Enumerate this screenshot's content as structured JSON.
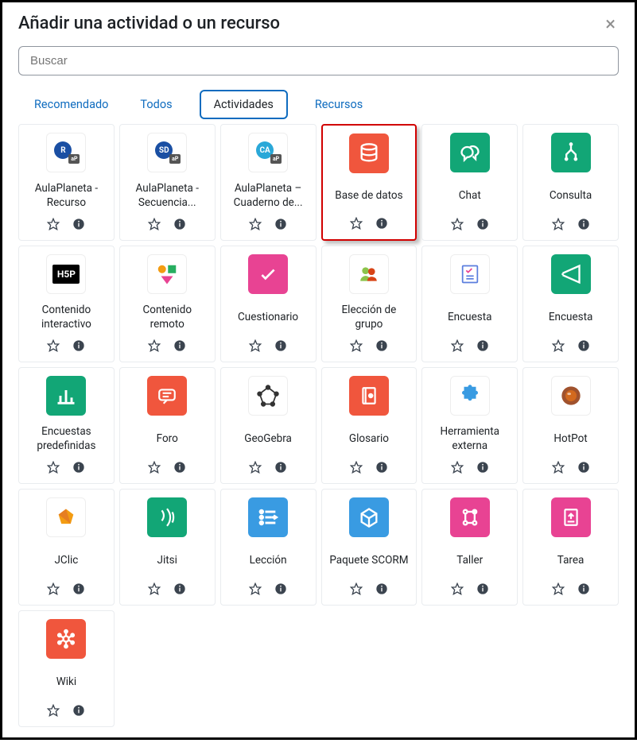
{
  "header": {
    "title": "Añadir una actividad o un recurso"
  },
  "search": {
    "placeholder": "Buscar"
  },
  "tabs": [
    {
      "label": "Recomendado",
      "active": false
    },
    {
      "label": "Todos",
      "active": false
    },
    {
      "label": "Actividades",
      "active": true
    },
    {
      "label": "Recursos",
      "active": false
    }
  ],
  "activities": [
    {
      "label": "AulaPlaneta - Recurso",
      "icon": "ap-r",
      "bg": "bg-white",
      "highlighted": false
    },
    {
      "label": "AulaPlaneta - Secuencia...",
      "icon": "ap-sd",
      "bg": "bg-white",
      "highlighted": false
    },
    {
      "label": "AulaPlaneta – Cuaderno de...",
      "icon": "ap-ca",
      "bg": "bg-white",
      "highlighted": false
    },
    {
      "label": "Base de datos",
      "icon": "database",
      "bg": "bg-orange",
      "highlighted": true
    },
    {
      "label": "Chat",
      "icon": "chat",
      "bg": "bg-green",
      "highlighted": false
    },
    {
      "label": "Consulta",
      "icon": "choice",
      "bg": "bg-green",
      "highlighted": false
    },
    {
      "label": "Contenido interactivo",
      "icon": "h5p",
      "bg": "bg-white",
      "highlighted": false
    },
    {
      "label": "Contenido remoto",
      "icon": "shapes",
      "bg": "bg-white",
      "highlighted": false
    },
    {
      "label": "Cuestionario",
      "icon": "quiz",
      "bg": "bg-pink",
      "highlighted": false
    },
    {
      "label": "Elección de grupo",
      "icon": "group",
      "bg": "bg-white",
      "highlighted": false
    },
    {
      "label": "Encuesta",
      "icon": "survey1",
      "bg": "bg-white",
      "highlighted": false
    },
    {
      "label": "Encuesta",
      "icon": "survey2",
      "bg": "bg-green",
      "highlighted": false
    },
    {
      "label": "Encuestas predefinidas",
      "icon": "barchart",
      "bg": "bg-green",
      "highlighted": false
    },
    {
      "label": "Foro",
      "icon": "forum",
      "bg": "bg-orange",
      "highlighted": false
    },
    {
      "label": "GeoGebra",
      "icon": "geogebra",
      "bg": "bg-white",
      "highlighted": false
    },
    {
      "label": "Glosario",
      "icon": "glossary",
      "bg": "bg-orange",
      "highlighted": false
    },
    {
      "label": "Herramienta externa",
      "icon": "puzzle",
      "bg": "bg-white",
      "highlighted": false
    },
    {
      "label": "HotPot",
      "icon": "hotpot",
      "bg": "bg-white",
      "highlighted": false
    },
    {
      "label": "JClic",
      "icon": "jclic",
      "bg": "bg-white",
      "highlighted": false
    },
    {
      "label": "Jitsi",
      "icon": "jitsi",
      "bg": "bg-green",
      "highlighted": false
    },
    {
      "label": "Lección",
      "icon": "lesson",
      "bg": "bg-blue",
      "highlighted": false
    },
    {
      "label": "Paquete SCORM",
      "icon": "scorm",
      "bg": "bg-blue",
      "highlighted": false
    },
    {
      "label": "Taller",
      "icon": "workshop",
      "bg": "bg-pink",
      "highlighted": false
    },
    {
      "label": "Tarea",
      "icon": "assign",
      "bg": "bg-pink",
      "highlighted": false
    },
    {
      "label": "Wiki",
      "icon": "wiki",
      "bg": "bg-orange",
      "highlighted": false
    }
  ]
}
